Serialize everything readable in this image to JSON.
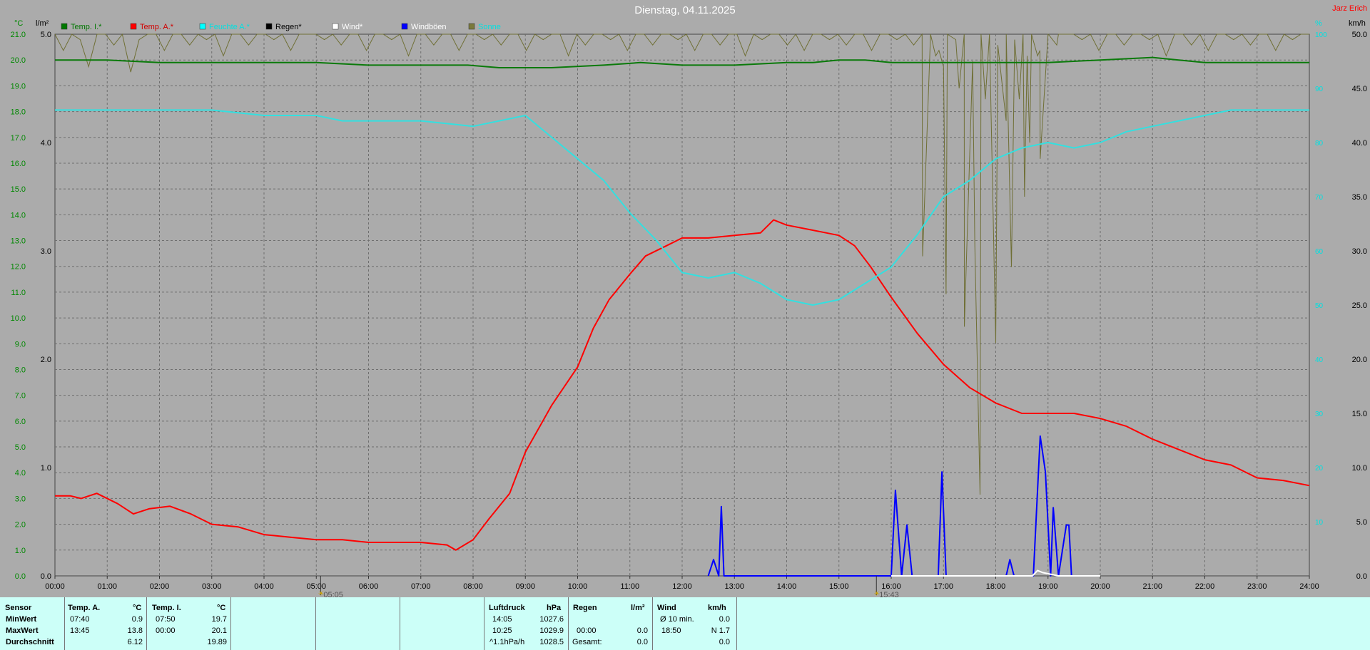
{
  "title": "Dienstag, 04.11.2025",
  "brand": "Jarz Erich",
  "units": {
    "left_temp": "°C",
    "left_rain": "l/m²",
    "right_pct": "%",
    "right_wind": "km/h"
  },
  "legend": [
    {
      "label": "Temp. I.*",
      "color": "#007700",
      "text_color": "#007700"
    },
    {
      "label": "Temp. A.*",
      "color": "#ff0000",
      "text_color": "#d00000"
    },
    {
      "label": "Feuchte A.*",
      "color": "#00ffff",
      "text_color": "#00e0e0"
    },
    {
      "label": "Regen*",
      "color": "#000000",
      "text_color": "#000000"
    },
    {
      "label": "Wind*",
      "color": "#ffffff",
      "text_color": "#ffffff"
    },
    {
      "label": "Windböen",
      "color": "#0000ff",
      "text_color": "#ffffff"
    },
    {
      "label": "Sonne",
      "color": "#7a7a3c",
      "text_color": "#00e0e0"
    }
  ],
  "sun": {
    "rise": "05:05",
    "set": "15:43"
  },
  "chart_data": {
    "type": "line",
    "x_unit": "hour",
    "x_ticks": [
      "00:00",
      "01:00",
      "02:00",
      "03:00",
      "04:00",
      "05:00",
      "06:00",
      "07:00",
      "08:00",
      "09:00",
      "10:00",
      "11:00",
      "12:00",
      "13:00",
      "14:00",
      "15:00",
      "16:00",
      "17:00",
      "18:00",
      "19:00",
      "20:00",
      "21:00",
      "22:00",
      "23:00",
      "24:00"
    ],
    "y_left_temp": {
      "ticks": [
        "0.0",
        "1.0",
        "2.0",
        "3.0",
        "4.0",
        "5.0",
        "6.0",
        "7.0",
        "8.0",
        "9.0",
        "10.0",
        "11.0",
        "12.0",
        "13.0",
        "14.0",
        "15.0",
        "16.0",
        "17.0",
        "18.0",
        "19.0",
        "20.0",
        "21.0"
      ],
      "range": [
        0,
        21
      ]
    },
    "y_left_rain": {
      "ticks": [
        "1.0",
        "2.0",
        "3.0",
        "4.0",
        "5.0"
      ],
      "range": [
        0,
        5
      ]
    },
    "y_right_pct": {
      "ticks": [
        "10",
        "20",
        "30",
        "40",
        "50",
        "60",
        "70",
        "80",
        "90",
        "100"
      ],
      "range": [
        0,
        100
      ]
    },
    "y_right_wind": {
      "ticks": [
        "0.0",
        "5.0",
        "10.0",
        "15.0",
        "20.0",
        "25.0",
        "30.0",
        "35.0",
        "40.0",
        "45.0",
        "50.0"
      ],
      "range": [
        0,
        50
      ]
    },
    "grid": true,
    "series": [
      {
        "name": "Temp. I.*",
        "axis": "temp",
        "color": "#0a7a0a",
        "points": [
          [
            0,
            20.0
          ],
          [
            1,
            20.0
          ],
          [
            2,
            19.9
          ],
          [
            3,
            19.9
          ],
          [
            4,
            19.9
          ],
          [
            5,
            19.9
          ],
          [
            6,
            19.8
          ],
          [
            7,
            19.8
          ],
          [
            7.9,
            19.8
          ],
          [
            8.5,
            19.7
          ],
          [
            9.5,
            19.7
          ],
          [
            10.5,
            19.8
          ],
          [
            11.2,
            19.9
          ],
          [
            12,
            19.8
          ],
          [
            13,
            19.8
          ],
          [
            14,
            19.9
          ],
          [
            14.5,
            19.9
          ],
          [
            15,
            20.0
          ],
          [
            15.5,
            20.0
          ],
          [
            16,
            19.9
          ],
          [
            17,
            19.9
          ],
          [
            18,
            19.9
          ],
          [
            19,
            19.9
          ],
          [
            20,
            20.0
          ],
          [
            21,
            20.1
          ],
          [
            21.5,
            20.0
          ],
          [
            22,
            19.9
          ],
          [
            23,
            19.9
          ],
          [
            24,
            19.9
          ]
        ]
      },
      {
        "name": "Temp. A.*",
        "axis": "temp",
        "color": "#ff0000",
        "points": [
          [
            0,
            3.1
          ],
          [
            0.3,
            3.1
          ],
          [
            0.5,
            3.0
          ],
          [
            0.8,
            3.2
          ],
          [
            1.2,
            2.8
          ],
          [
            1.5,
            2.4
          ],
          [
            1.8,
            2.6
          ],
          [
            2.2,
            2.7
          ],
          [
            2.6,
            2.4
          ],
          [
            3,
            2.0
          ],
          [
            3.5,
            1.9
          ],
          [
            4,
            1.6
          ],
          [
            4.5,
            1.5
          ],
          [
            5,
            1.4
          ],
          [
            5.5,
            1.4
          ],
          [
            6,
            1.3
          ],
          [
            6.5,
            1.3
          ],
          [
            7,
            1.3
          ],
          [
            7.5,
            1.2
          ],
          [
            7.67,
            1.0
          ],
          [
            8,
            1.4
          ],
          [
            8.3,
            2.2
          ],
          [
            8.7,
            3.2
          ],
          [
            9,
            4.8
          ],
          [
            9.5,
            6.6
          ],
          [
            10,
            8.1
          ],
          [
            10.3,
            9.6
          ],
          [
            10.6,
            10.7
          ],
          [
            11,
            11.7
          ],
          [
            11.3,
            12.4
          ],
          [
            11.7,
            12.8
          ],
          [
            12,
            13.1
          ],
          [
            12.5,
            13.1
          ],
          [
            13,
            13.2
          ],
          [
            13.5,
            13.3
          ],
          [
            13.75,
            13.8
          ],
          [
            14,
            13.6
          ],
          [
            14.5,
            13.4
          ],
          [
            15,
            13.2
          ],
          [
            15.3,
            12.8
          ],
          [
            15.6,
            12.0
          ],
          [
            16,
            10.8
          ],
          [
            16.5,
            9.4
          ],
          [
            17,
            8.2
          ],
          [
            17.5,
            7.3
          ],
          [
            18,
            6.7
          ],
          [
            18.5,
            6.3
          ],
          [
            19,
            6.3
          ],
          [
            19.5,
            6.3
          ],
          [
            20,
            6.1
          ],
          [
            20.5,
            5.8
          ],
          [
            21,
            5.3
          ],
          [
            21.5,
            4.9
          ],
          [
            22,
            4.5
          ],
          [
            22.5,
            4.3
          ],
          [
            23,
            3.8
          ],
          [
            23.5,
            3.7
          ],
          [
            24,
            3.5
          ]
        ]
      },
      {
        "name": "Feuchte A.*",
        "axis": "pct",
        "color": "#33e0e0",
        "points": [
          [
            0,
            86
          ],
          [
            2,
            86
          ],
          [
            3,
            86
          ],
          [
            4,
            85
          ],
          [
            5,
            85
          ],
          [
            5.5,
            84
          ],
          [
            6,
            84
          ],
          [
            7,
            84
          ],
          [
            8,
            83
          ],
          [
            9,
            85
          ],
          [
            9.5,
            81
          ],
          [
            10,
            77
          ],
          [
            10.5,
            73
          ],
          [
            11,
            67
          ],
          [
            11.5,
            62
          ],
          [
            12,
            56
          ],
          [
            12.5,
            55
          ],
          [
            13,
            56
          ],
          [
            13.5,
            54
          ],
          [
            14,
            51
          ],
          [
            14.5,
            50
          ],
          [
            15,
            51
          ],
          [
            15.5,
            54
          ],
          [
            16,
            57
          ],
          [
            16.5,
            63
          ],
          [
            17,
            70
          ],
          [
            17.5,
            73
          ],
          [
            18,
            77
          ],
          [
            18.5,
            79
          ],
          [
            19,
            80
          ],
          [
            19.5,
            79
          ],
          [
            20,
            80
          ],
          [
            20.5,
            82
          ],
          [
            21,
            83
          ],
          [
            21.5,
            84
          ],
          [
            22,
            85
          ],
          [
            22.5,
            86
          ],
          [
            23,
            86
          ],
          [
            24,
            86
          ]
        ]
      },
      {
        "name": "Windböen",
        "axis": "wind",
        "color": "#0000ff",
        "points": [
          [
            12.5,
            0
          ],
          [
            12.6,
            1.5
          ],
          [
            12.7,
            0
          ],
          [
            12.75,
            6.4
          ],
          [
            12.8,
            0
          ],
          [
            16,
            0
          ],
          [
            16.08,
            7.9
          ],
          [
            16.2,
            0
          ],
          [
            16.3,
            4.7
          ],
          [
            16.4,
            0
          ],
          [
            16.9,
            0
          ],
          [
            16.97,
            9.6
          ],
          [
            17.05,
            0
          ],
          [
            18.2,
            0
          ],
          [
            18.27,
            1.5
          ],
          [
            18.35,
            0
          ],
          [
            18.72,
            0
          ],
          [
            18.85,
            12.9
          ],
          [
            18.95,
            9.6
          ],
          [
            19.05,
            0
          ],
          [
            19.1,
            6.3
          ],
          [
            19.2,
            0
          ],
          [
            19.35,
            4.7
          ],
          [
            19.4,
            4.7
          ],
          [
            19.45,
            0
          ]
        ]
      },
      {
        "name": "Wind*",
        "axis": "wind",
        "color": "#ffffff",
        "points": [
          [
            16,
            0
          ],
          [
            18.7,
            0
          ],
          [
            18.8,
            0.5
          ],
          [
            18.9,
            0.3
          ],
          [
            19.2,
            0
          ],
          [
            20,
            0
          ]
        ]
      }
    ],
    "sun_values_pct": [
      100,
      97,
      100,
      99,
      94,
      100,
      100,
      98,
      100,
      93,
      99,
      100,
      100,
      97,
      100,
      100,
      98,
      100,
      99,
      100,
      96,
      100,
      100,
      98,
      100,
      100,
      99,
      100,
      97,
      100,
      100,
      100,
      99,
      100,
      98,
      100,
      100,
      97,
      100,
      100,
      99,
      100,
      96,
      100,
      100,
      98,
      100,
      100,
      97,
      100,
      100,
      99,
      100,
      98,
      100,
      100,
      97,
      100,
      99,
      100,
      100,
      96,
      100,
      98,
      100,
      100,
      99,
      100,
      97,
      100,
      100,
      98,
      100,
      100,
      99,
      100,
      97,
      100,
      100,
      98,
      100,
      100,
      96,
      100,
      99,
      100,
      100,
      98,
      100,
      97,
      100,
      100,
      99,
      100,
      98,
      100,
      100,
      97,
      100,
      100,
      99,
      100,
      98,
      100,
      100,
      97,
      100,
      99,
      100,
      95,
      100,
      100,
      98,
      100,
      99,
      100,
      100,
      97,
      100,
      98,
      100,
      100,
      99,
      100,
      97,
      100,
      100,
      98,
      100,
      100,
      99,
      100,
      96,
      100,
      100,
      98,
      100,
      97,
      100,
      100,
      99,
      100,
      98,
      100,
      100,
      97,
      100,
      99,
      100,
      100
    ],
    "sun_dips": [
      [
        16.6,
        59
      ],
      [
        16.85,
        96
      ],
      [
        17.0,
        94
      ],
      [
        17.05,
        52
      ],
      [
        17.3,
        90
      ],
      [
        17.4,
        46
      ],
      [
        17.6,
        61
      ],
      [
        17.8,
        88
      ],
      [
        18.0,
        43
      ],
      [
        18.2,
        84
      ],
      [
        18.3,
        57
      ],
      [
        18.45,
        88
      ],
      [
        18.55,
        70
      ],
      [
        18.6,
        96
      ],
      [
        18.65,
        80
      ],
      [
        18.8,
        96
      ],
      [
        18.85,
        77
      ],
      [
        19.0,
        100
      ],
      [
        19.2,
        100
      ],
      [
        17.7,
        15
      ]
    ]
  },
  "stats": {
    "headers": {
      "sensor": "Sensor",
      "temp_a": "Temp. A.",
      "temp_a_unit": "°C",
      "temp_i": "Temp. I.",
      "temp_i_unit": "°C",
      "pressure": "Luftdruck",
      "pressure_unit": "hPa",
      "rain": "Regen",
      "rain_unit": "l/m²",
      "wind": "Wind",
      "wind_unit": "km/h"
    },
    "rows": [
      "MinWert",
      "MaxWert",
      "Durchschnitt"
    ],
    "temp_a": {
      "min_time": "07:40",
      "min": "0.9",
      "max_time": "13:45",
      "max": "13.8",
      "avg": "6.12"
    },
    "temp_i": {
      "min_time": "07:50",
      "min": "19.7",
      "max_time": "00:00",
      "max": "20.1",
      "avg": "19.89"
    },
    "pressure": {
      "min_time": "14:05",
      "min": "1027.6",
      "max_time": "10:25",
      "max": "1029.9",
      "trend": "^1.1hPa/h",
      "avg": "1028.5"
    },
    "rain": {
      "time": "00:00",
      "max": "0.0",
      "total_label": "Gesamt:",
      "total": "0.0"
    },
    "wind": {
      "avg_label": "Ø 10 min.",
      "avg": "0.0",
      "max_time": "18:50",
      "max": "N 1.7",
      "mean": "0.0"
    }
  }
}
